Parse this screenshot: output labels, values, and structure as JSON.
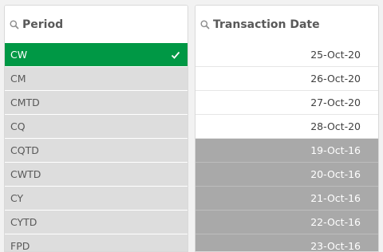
{
  "colors": {
    "selected": "#009845",
    "alternative": "#dddddd",
    "possible": "#ffffff",
    "excluded": "#a9a9a9",
    "title_text": "#595959"
  },
  "period_listbox": {
    "title": "Period",
    "search_icon": "search-icon",
    "items": [
      {
        "label": "CW",
        "state": "selected",
        "icon": "check-icon"
      },
      {
        "label": "CM",
        "state": "alternative"
      },
      {
        "label": "CMTD",
        "state": "alternative"
      },
      {
        "label": "CQ",
        "state": "alternative"
      },
      {
        "label": "CQTD",
        "state": "alternative"
      },
      {
        "label": "CWTD",
        "state": "alternative"
      },
      {
        "label": "CY",
        "state": "alternative"
      },
      {
        "label": "CYTD",
        "state": "alternative"
      },
      {
        "label": "FPD",
        "state": "alternative"
      }
    ]
  },
  "date_listbox": {
    "title": "Transaction Date",
    "search_icon": "search-icon",
    "items": [
      {
        "label": "25-Oct-20",
        "state": "possible"
      },
      {
        "label": "26-Oct-20",
        "state": "possible"
      },
      {
        "label": "27-Oct-20",
        "state": "possible"
      },
      {
        "label": "28-Oct-20",
        "state": "possible"
      },
      {
        "label": "19-Oct-16",
        "state": "excluded"
      },
      {
        "label": "20-Oct-16",
        "state": "excluded"
      },
      {
        "label": "21-Oct-16",
        "state": "excluded"
      },
      {
        "label": "22-Oct-16",
        "state": "excluded"
      },
      {
        "label": "23-Oct-16",
        "state": "excluded"
      }
    ]
  }
}
